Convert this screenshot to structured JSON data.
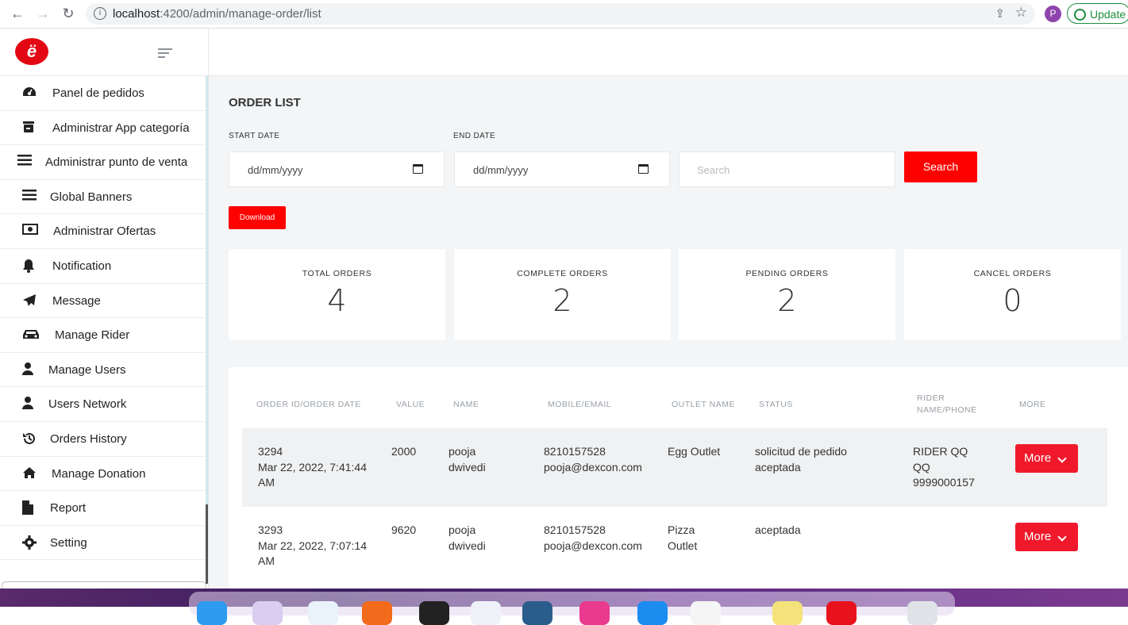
{
  "browser": {
    "url_host": "localhost",
    "url_path": ":4200/admin/manage-order/list",
    "profile_initial": "P",
    "update_label": "Update"
  },
  "sidebar": {
    "logo_text": "ë",
    "items": [
      {
        "label": "Panel de pedidos",
        "icon": "dashboard-icon"
      },
      {
        "label": "Administrar App categoría",
        "icon": "store-icon"
      },
      {
        "label": "Administrar punto de venta",
        "icon": "bars-icon"
      },
      {
        "label": "Global Banners",
        "icon": "bars-icon"
      },
      {
        "label": "Administrar Ofertas",
        "icon": "money-icon"
      },
      {
        "label": "Notification",
        "icon": "bell-icon"
      },
      {
        "label": "Message",
        "icon": "paper-plane-icon"
      },
      {
        "label": "Manage Rider",
        "icon": "car-icon"
      },
      {
        "label": "Manage Users",
        "icon": "user-icon"
      },
      {
        "label": "Users Network",
        "icon": "user-icon"
      },
      {
        "label": "Orders History",
        "icon": "history-icon"
      },
      {
        "label": "Manage Donation",
        "icon": "home-icon"
      },
      {
        "label": "Report",
        "icon": "file-icon"
      },
      {
        "label": "Setting",
        "icon": "gear-icon"
      }
    ]
  },
  "main": {
    "title": "ORDER LIST",
    "start_date_label": "START DATE",
    "end_date_label": "END DATE",
    "start_date_value": "dd/mm/yyyy",
    "end_date_value": "dd/mm/yyyy",
    "search_placeholder": "Search",
    "search_button": "Search",
    "download_button": "Download"
  },
  "stats": [
    {
      "label": "TOTAL ORDERS",
      "value": "4"
    },
    {
      "label": "COMPLETE ORDERS",
      "value": "2"
    },
    {
      "label": "PENDING ORDERS",
      "value": "2"
    },
    {
      "label": "CANCEL ORDERS",
      "value": "0"
    }
  ],
  "table": {
    "headers": [
      "ORDER ID/ORDER DATE",
      "VALUE",
      "NAME",
      "MOBILE/EMAIL",
      "OUTLET NAME",
      "STATUS",
      "RIDER NAME/PHONE",
      "MORE"
    ],
    "rows": [
      {
        "id_date": "3294\nMar 22, 2022, 7:41:44\nAM",
        "value": "2000",
        "name": "pooja\ndwivedi",
        "mobile_email": "8210157528\npooja@dexcon.com",
        "outlet": "Egg Outlet",
        "status": "solicitud de pedido\naceptada",
        "rider": "RIDER QQ\nQQ\n9999000157",
        "more": "More"
      },
      {
        "id_date": "3293\nMar 22, 2022, 7:07:14\nAM",
        "value": "9620",
        "name": "pooja\ndwivedi",
        "mobile_email": "8210157528\npooja@dexcon.com",
        "outlet": "Pizza\nOutlet",
        "status": "aceptada",
        "rider": "",
        "more": "More"
      }
    ]
  },
  "colors": {
    "accent": "#ff0000",
    "more_button": "#f0192b",
    "page_bg": "#f3f5f7"
  }
}
